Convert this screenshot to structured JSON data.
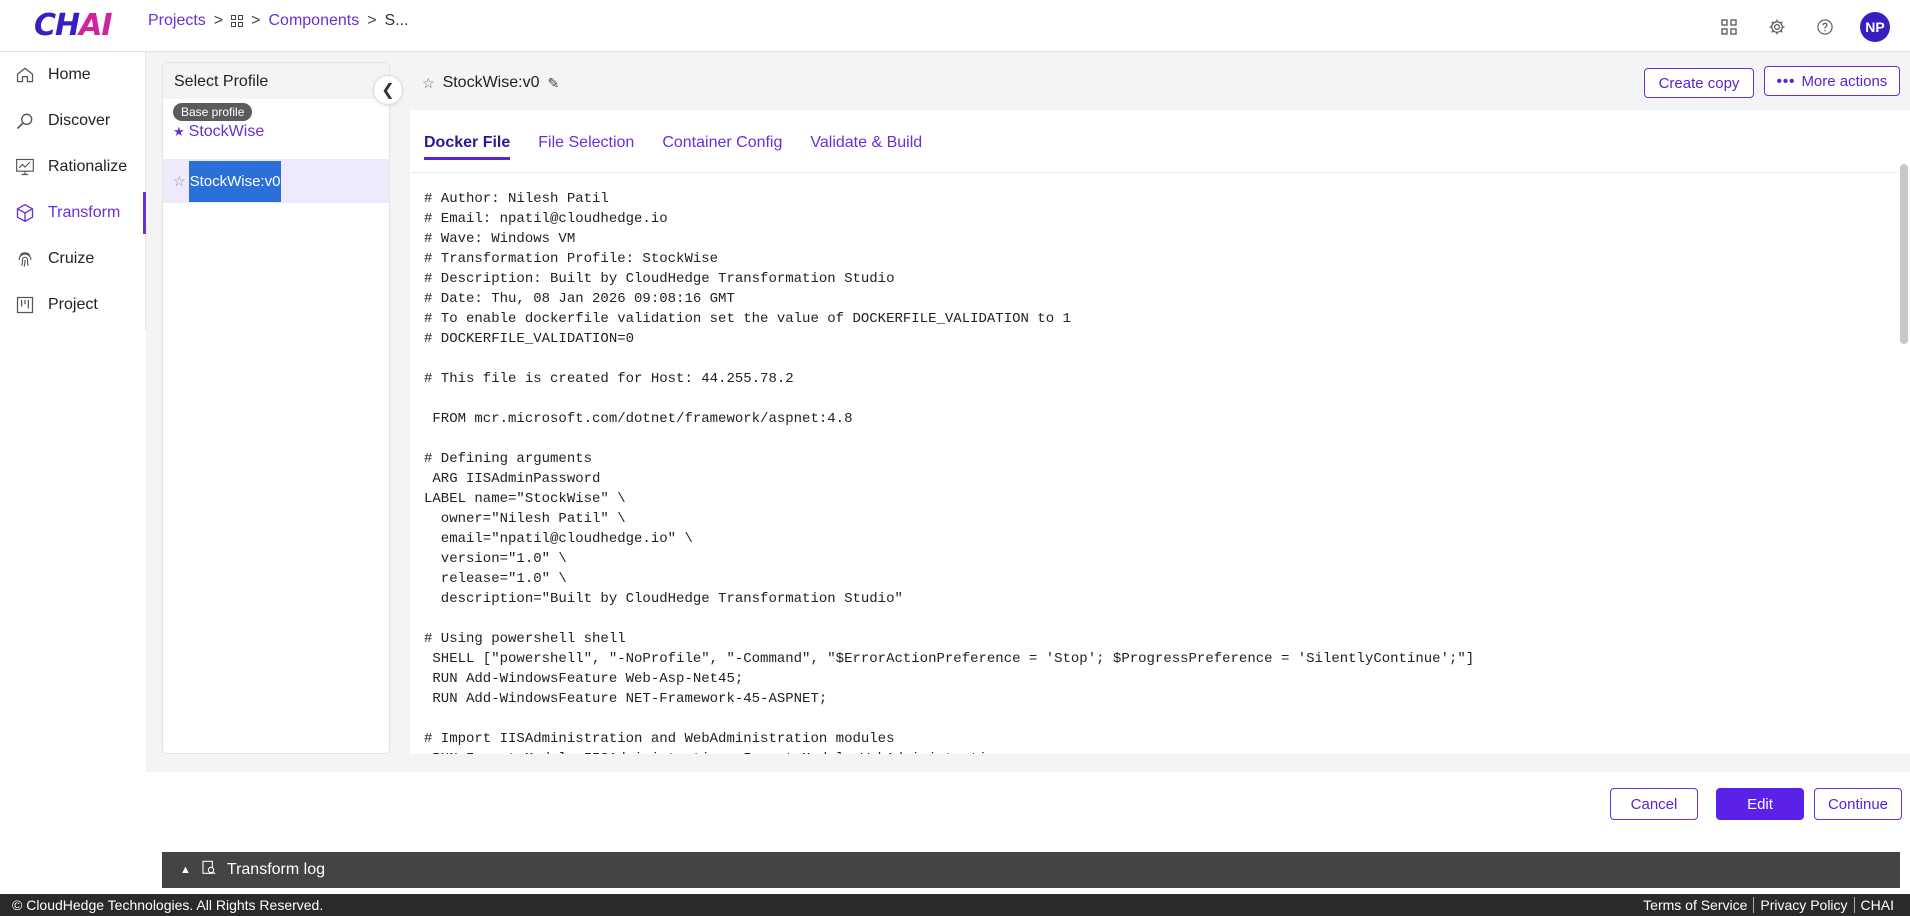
{
  "app": {
    "logo_main": "CH",
    "logo_accent": "AI"
  },
  "breadcrumb": {
    "projects": "Projects",
    "sep": ">",
    "components": "Components",
    "current": "S..."
  },
  "header": {
    "avatar_initials": "NP"
  },
  "nav": {
    "items": [
      {
        "label": "Home",
        "icon": "home-icon"
      },
      {
        "label": "Discover",
        "icon": "discover-icon"
      },
      {
        "label": "Rationalize",
        "icon": "rationalize-icon"
      },
      {
        "label": "Transform",
        "icon": "cube-icon"
      },
      {
        "label": "Cruize",
        "icon": "fingerprint-icon"
      },
      {
        "label": "Project",
        "icon": "board-icon"
      }
    ]
  },
  "profile": {
    "header": "Select Profile",
    "base_badge": "Base profile",
    "base_name": "StockWise",
    "selected_name": "StockWise:v0"
  },
  "content": {
    "title": "StockWise:v0",
    "create_copy": "Create copy",
    "more_actions": "More actions",
    "tabs": [
      "Docker File",
      "File Selection",
      "Container Config",
      "Validate & Build"
    ],
    "code": "# Author: Nilesh Patil\n# Email: npatil@cloudhedge.io\n# Wave: Windows VM\n# Transformation Profile: StockWise\n# Description: Built by CloudHedge Transformation Studio\n# Date: Thu, 08 Jan 2026 09:08:16 GMT\n# To enable dockerfile validation set the value of DOCKERFILE_VALIDATION to 1\n# DOCKERFILE_VALIDATION=0\n\n# This file is created for Host: 44.255.78.2\n\n FROM mcr.microsoft.com/dotnet/framework/aspnet:4.8\n\n# Defining arguments\n ARG IISAdminPassword\nLABEL name=\"StockWise\" \\\n  owner=\"Nilesh Patil\" \\\n  email=\"npatil@cloudhedge.io\" \\\n  version=\"1.0\" \\\n  release=\"1.0\" \\\n  description=\"Built by CloudHedge Transformation Studio\"\n\n# Using powershell shell\n SHELL [\"powershell\", \"-NoProfile\", \"-Command\", \"$ErrorActionPreference = 'Stop'; $ProgressPreference = 'SilentlyContinue';\"]\n RUN Add-WindowsFeature Web-Asp-Net45;\n RUN Add-WindowsFeature NET-Framework-45-ASPNET;\n\n# Import IISAdministration and WebAdministration modules\n RUN Import-Module IISAdministration; Import-Module WebAdministration;"
  },
  "actions": {
    "cancel": "Cancel",
    "edit": "Edit",
    "continue": "Continue"
  },
  "log": {
    "label": "Transform log"
  },
  "footer": {
    "copyright": "© CloudHedge Technologies. All Rights Reserved.",
    "terms": "Terms of Service",
    "privacy": "Privacy Policy",
    "brand": "CHAI"
  },
  "colors": {
    "accent": "#6a2fd8",
    "primary_button": "#5a22e8",
    "selected_bg": "#2b6fd9"
  }
}
